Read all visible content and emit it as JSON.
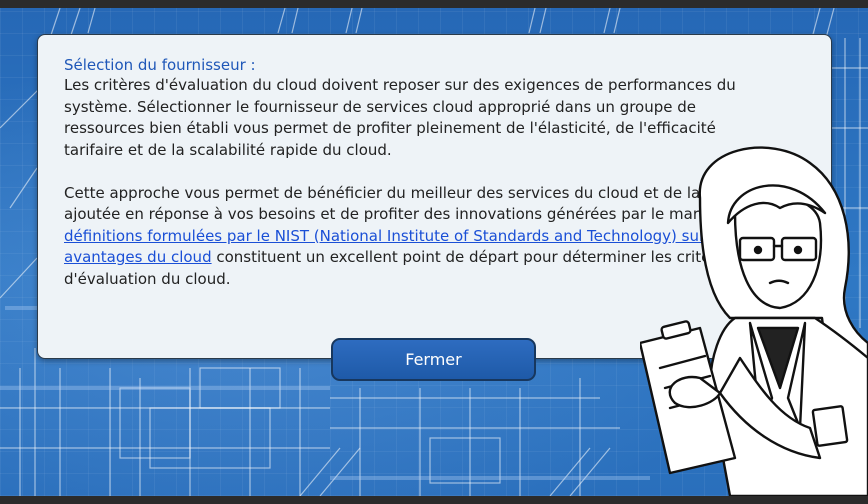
{
  "dialog": {
    "title": "Sélection du fournisseur :",
    "paragraph1": "Les critères d'évaluation du cloud doivent reposer sur des exigences de performances du système. Sélectionner le fournisseur de services cloud approprié dans un groupe de ressources bien établi vous permet de profiter pleinement de l'élasticité, de l'efficacité tarifaire et de la scalabilité rapide du cloud.",
    "paragraph2_before": "Cette approche vous permet de bénéficier du meilleur des services du cloud et de la valeur ajoutée en réponse à vos besoins et de profiter des innovations générées par le marché. Les ",
    "link_text": "définitions formulées par le NIST (National Institute of Standards and Technology) sur les avantages du cloud",
    "paragraph2_after": " constituent un excellent point de départ pour déterminer les critères d'évaluation du cloud.",
    "close_label": "Fermer"
  },
  "colors": {
    "background": "#2a6fbc",
    "title": "#1f57b8",
    "link": "#1a4fd6",
    "button": "#1e5aa8",
    "dialog_bg": "#eef3f7"
  },
  "icons": {
    "character": "woman-with-clipboard-illustration"
  }
}
